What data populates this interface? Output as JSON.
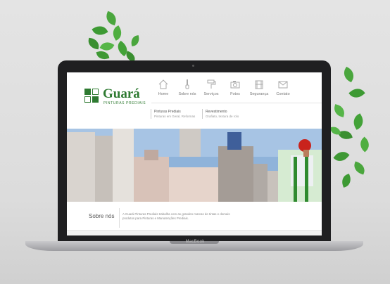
{
  "site": {
    "logo": {
      "title": "Guará",
      "subtitle": "PINTURAS PREDIAIS"
    },
    "nav": [
      {
        "label": "Home",
        "icon": "house-icon"
      },
      {
        "label": "Sobre nós",
        "icon": "brush-icon"
      },
      {
        "label": "Serviços",
        "icon": "roller-icon"
      },
      {
        "label": "Fotos",
        "icon": "camera-icon"
      },
      {
        "label": "Segurança",
        "icon": "harness-icon"
      },
      {
        "label": "Contato",
        "icon": "envelope-icon"
      }
    ],
    "submenu": [
      {
        "title": "Pinturas Prediais",
        "subtitle": "Pinturas em Geral, Reformas"
      },
      {
        "title": "Revestimento",
        "subtitle": "Grafiato, textura de rolo"
      }
    ],
    "about": {
      "title": "Sobre nós",
      "text": "A Guará Pinturas Prediais trabalha com as grandes marcas de tintas e demais produtos para Pinturas e Manutenções Prediais."
    }
  },
  "laptop": {
    "brand": "MacBook"
  },
  "colors": {
    "brand_green": "#2e7a31",
    "plant_green": "#3f9a35"
  }
}
